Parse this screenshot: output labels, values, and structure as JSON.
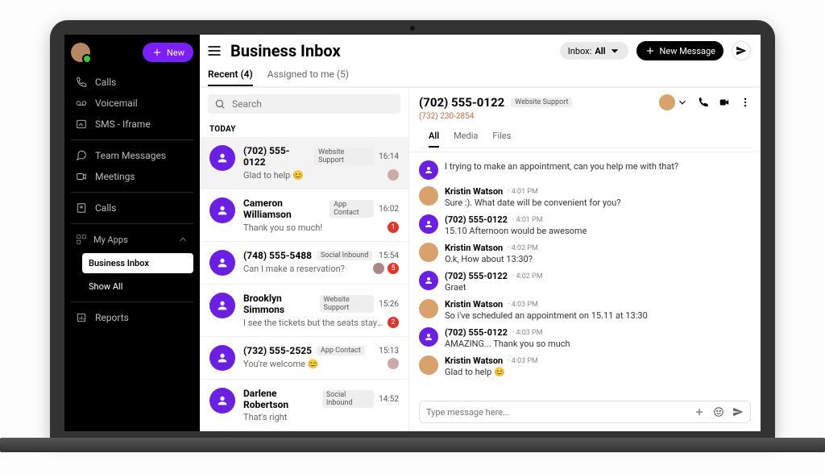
{
  "sidebar": {
    "new_label": "New",
    "nav": [
      {
        "label": "Calls"
      },
      {
        "label": "Voicemail"
      },
      {
        "label": "SMS - Iframe"
      },
      {
        "label": "Team Messages"
      },
      {
        "label": "Meetings"
      },
      {
        "label": "Calls"
      }
    ],
    "myapps_label": "My Apps",
    "business_inbox": "Business Inbox",
    "show_all": "Show All",
    "reports": "Reports"
  },
  "header": {
    "title": "Business Inbox",
    "inbox_label": "Inbox:",
    "inbox_value": "All",
    "new_message": "New Message"
  },
  "inbox_tabs": {
    "recent": "Recent (4)",
    "assigned": "Assigned to me (5)"
  },
  "search": {
    "placeholder": "Search"
  },
  "section_today": "TODAY",
  "conversations": [
    {
      "name": "(702) 555-0122",
      "tag": "Website Support",
      "time": "16:14",
      "preview": "Glad to help 😊",
      "selected": true,
      "showMini": true
    },
    {
      "name": "Cameron Williamson",
      "tag": "App Contact",
      "time": "16:02",
      "preview": "Thank you so much!",
      "badge": "1"
    },
    {
      "name": "(748) 555-5488",
      "tag": "Social Inbound",
      "time": "15:54",
      "preview": "Can I make a reservation?",
      "showMini2": true,
      "badge": "5"
    },
    {
      "name": "Brooklyn Simmons",
      "tag": "Website Support",
      "time": "15:26",
      "preview": "I see the tickets but the seats stayed avail…",
      "badge": "2"
    },
    {
      "name": "(732) 555-2525",
      "tag": "App Contact",
      "time": "15:13",
      "preview": "You're welcome 😊",
      "showMini": true
    },
    {
      "name": "Darlene Robertson",
      "tag": "Social Inbound",
      "time": "14:52",
      "preview": "That's right"
    }
  ],
  "thread": {
    "title": "(702) 555-0122",
    "tag": "Website Support",
    "sub": "(732) 230-2854",
    "tabs": {
      "all": "All",
      "media": "Media",
      "files": "Files"
    },
    "messages": [
      {
        "who": "caller",
        "name": "",
        "time": "",
        "text": "I trying to make an appointment, can you help me with that?"
      },
      {
        "who": "agent",
        "name": "Kristin Watson",
        "time": "4:01 PM",
        "text": "Sure :). What date will be convenient for you?"
      },
      {
        "who": "caller",
        "name": "(702) 555-0122",
        "time": "4:01 PM",
        "text": "15.10 Afternoon would be awesome"
      },
      {
        "who": "agent",
        "name": "Kristin Watson",
        "time": "4:02 PM",
        "text": "O.k, How about 13:30?"
      },
      {
        "who": "caller",
        "name": "(702) 555-0122",
        "time": "4:02 PM",
        "text": "Graet"
      },
      {
        "who": "agent",
        "name": "Kristin Watson",
        "time": "4:03 PM",
        "text": "So i've scheduled an appointment on 15.11 at 13:30"
      },
      {
        "who": "caller",
        "name": "(702) 555-0122",
        "time": "4:03 PM",
        "text": "AMAZING... Thank you so much"
      },
      {
        "who": "agent",
        "name": "Kristin Watson",
        "time": "4:03 PM",
        "text": "Glad to help 😊"
      }
    ],
    "composer_placeholder": "Type message here..."
  }
}
